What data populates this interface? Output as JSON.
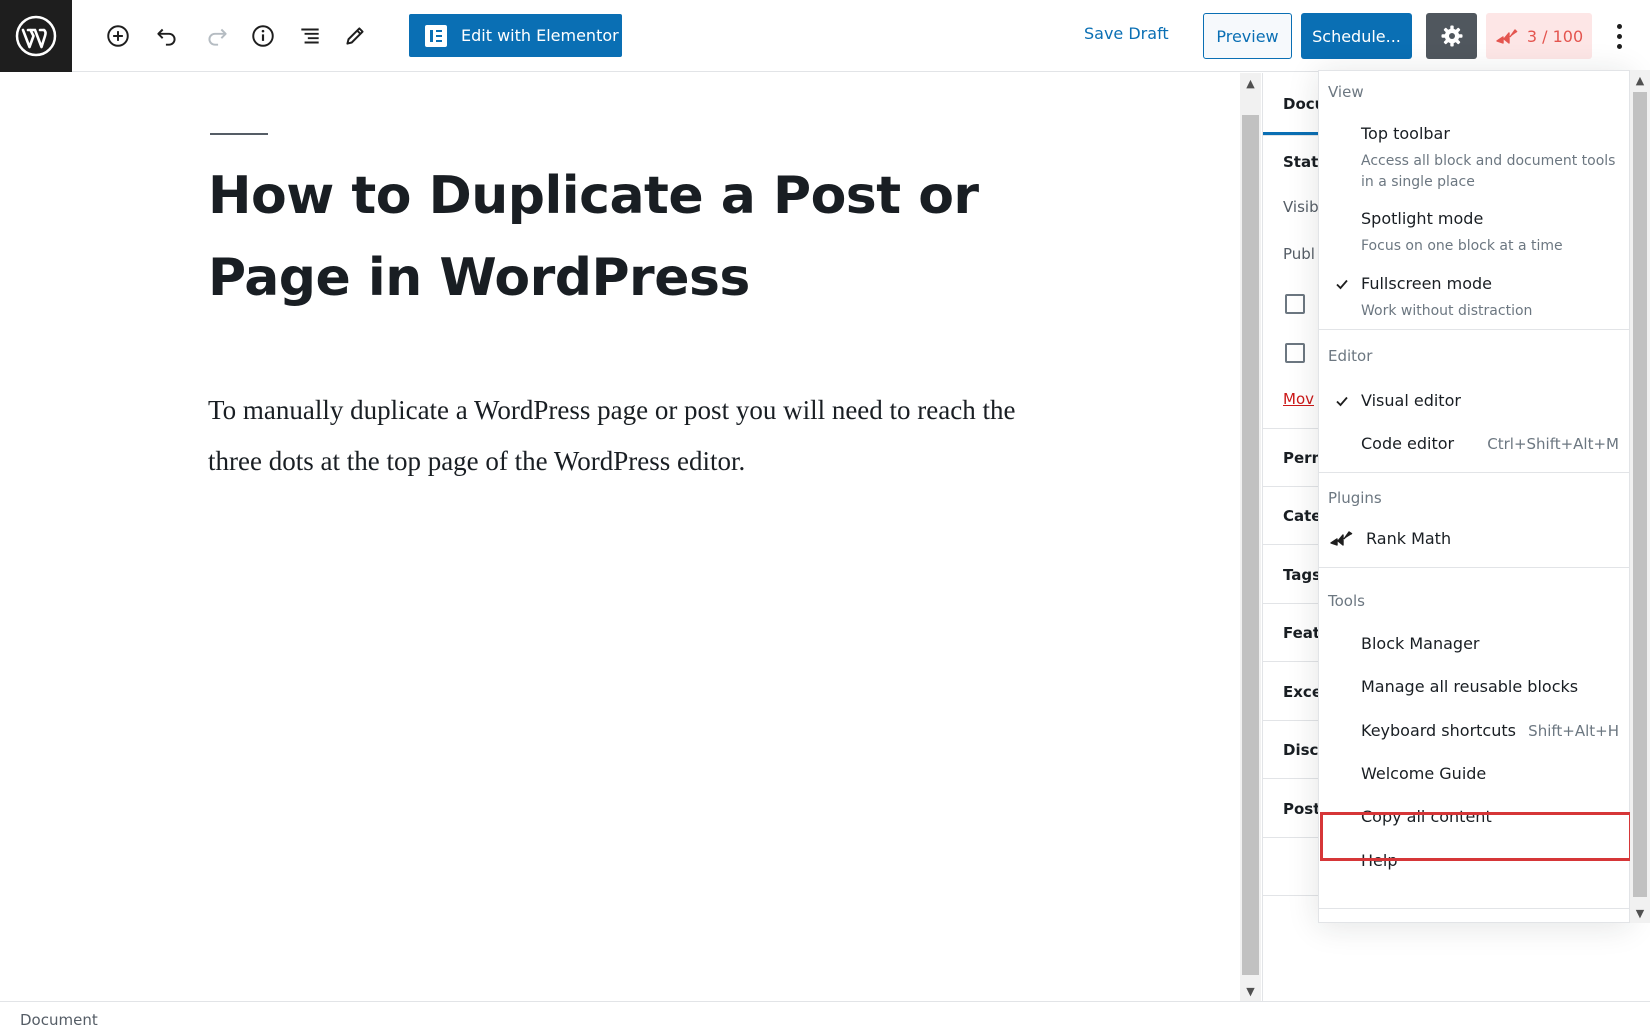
{
  "toolbar": {
    "elementor_label": "Edit with Elementor",
    "save_draft_label": "Save Draft",
    "preview_label": "Preview",
    "schedule_label": "Schedule...",
    "rank_math_score": "3 / 100",
    "icons": [
      "wordpress-logo-icon",
      "add-block-icon",
      "undo-icon",
      "redo-icon",
      "info-icon",
      "list-view-icon",
      "edit-tools-icon",
      "gear-icon",
      "rank-math-icon",
      "more-options-icon"
    ]
  },
  "editor": {
    "title": "How to Duplicate a Post or Page in WordPress",
    "body": "To manually duplicate a WordPress page or post you will need to reach the three dots at the top page of the WordPress editor."
  },
  "sidebar": {
    "tab": "Docu",
    "rows": {
      "status": "Statu",
      "visibility": "Visib",
      "publish": "Publ",
      "move": "Mov",
      "permalink": "Perm",
      "categories": "Cate",
      "tags": "Tags",
      "featured": "Featu",
      "excerpt": "Exce",
      "discussion": "Discu",
      "post": "Post"
    }
  },
  "menu": {
    "view": {
      "label": "View",
      "top_toolbar": {
        "label": "Top toolbar",
        "desc": "Access all block and document tools in a single place"
      },
      "spotlight": {
        "label": "Spotlight mode",
        "desc": "Focus on one block at a time"
      },
      "fullscreen": {
        "label": "Fullscreen mode",
        "desc": "Work without distraction"
      }
    },
    "editor": {
      "label": "Editor",
      "visual": "Visual editor",
      "code": "Code editor",
      "code_shortcut": "Ctrl+Shift+Alt+M"
    },
    "plugins": {
      "label": "Plugins",
      "rank_math": "Rank Math"
    },
    "tools": {
      "label": "Tools",
      "block_manager": "Block Manager",
      "reusable": "Manage all reusable blocks",
      "shortcuts": "Keyboard shortcuts",
      "shortcuts_key": "Shift+Alt+H",
      "welcome": "Welcome Guide",
      "copy_all": "Copy all content",
      "help": "Help"
    }
  },
  "footer": {
    "breadcrumb": "Document"
  },
  "colors": {
    "accent": "#0a6fb4",
    "dark": "#1e1e1e",
    "highlight": "#d63638",
    "rank_math": "#e4554f"
  }
}
